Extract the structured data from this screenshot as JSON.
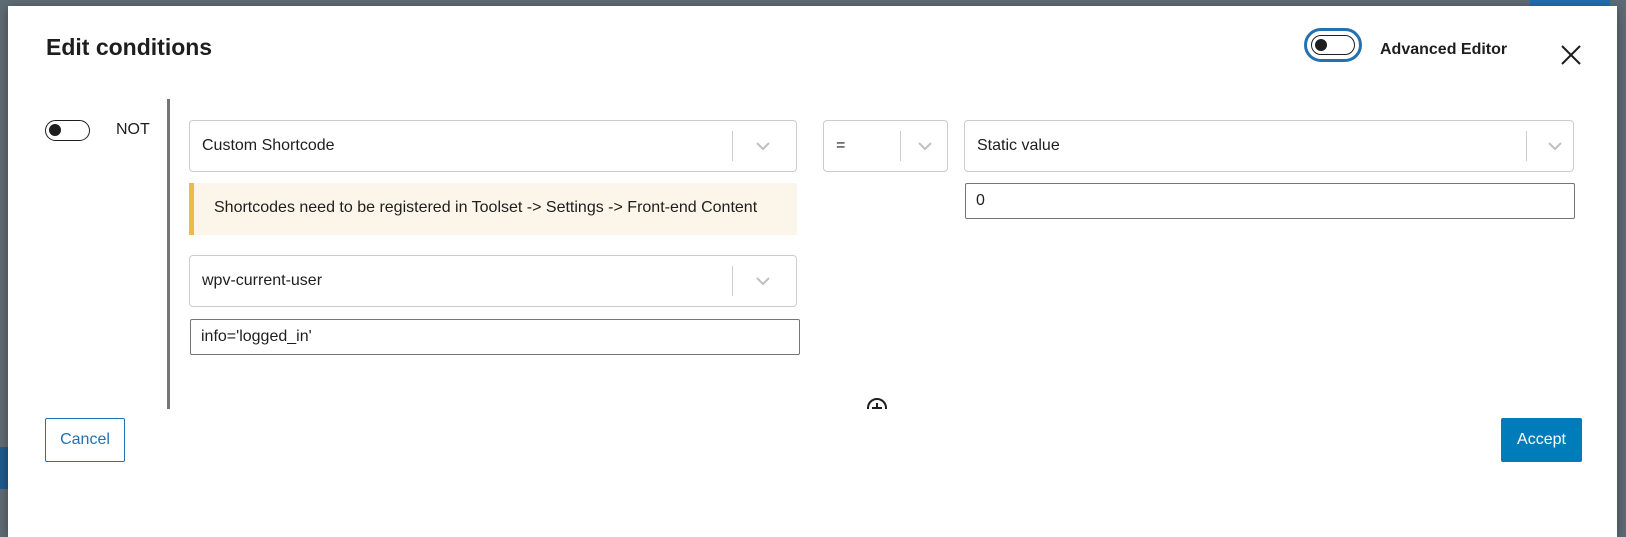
{
  "dialog": {
    "title": "Edit conditions",
    "advanced_editor_label": "Advanced Editor",
    "advanced_editor_enabled": false
  },
  "condition": {
    "not_label": "NOT",
    "not_enabled": false,
    "left_source": "Custom Shortcode",
    "operator": "=",
    "right_source": "Static value",
    "right_value": "0",
    "notice": "Shortcodes need to be registered in Toolset -> Settings -> Front-end Content",
    "shortcode": "wpv-current-user",
    "shortcode_attributes": "info='logged_in'"
  },
  "footer": {
    "cancel_label": "Cancel",
    "accept_label": "Accept"
  },
  "colors": {
    "accent": "#2271b1",
    "primary_button": "#007cba",
    "notice_border": "#f0b849",
    "notice_bg": "#fcf5ea"
  },
  "icons": [
    "close-icon",
    "chevron-down-icon",
    "add-condition-icon"
  ]
}
